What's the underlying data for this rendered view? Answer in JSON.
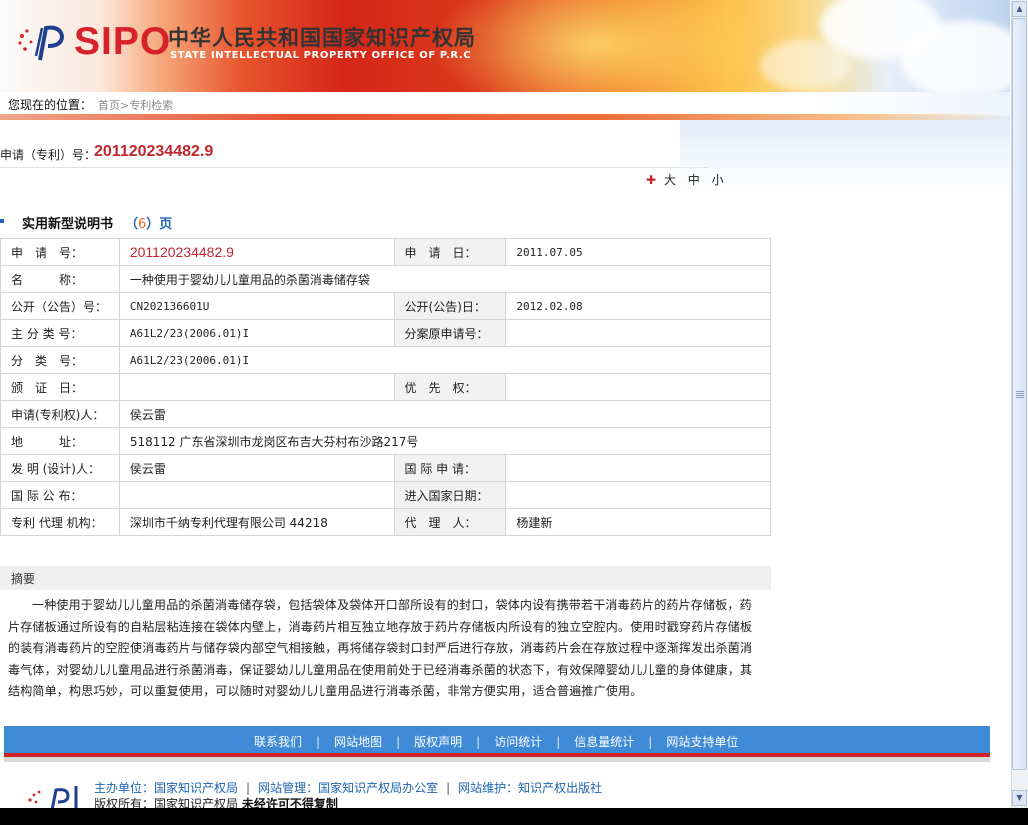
{
  "header": {
    "logo_text": "SIPO",
    "cn_title": "中华人民共和国国家知识产权局",
    "en_title": "STATE INTELLECTUAL PROPERTY OFFICE OF P.R.C"
  },
  "location": {
    "label": "您现在的位置：",
    "breadcrumb": "首页>专利检索"
  },
  "application": {
    "label": "申请（专利）号：",
    "number": "201120234482.9"
  },
  "font_size": {
    "plus": "✚",
    "large": "大",
    "medium": "中",
    "small": "小"
  },
  "section": {
    "title": "实用新型说明书",
    "pages_open": "（",
    "pages_num": "6",
    "pages_close": "）页"
  },
  "table": {
    "r1": {
      "l1": "申　请　号：",
      "v1": "201120234482.9",
      "l2": "申　请　日：",
      "v2": "2011.07.05"
    },
    "r2": {
      "l1": "名　　　称：",
      "v1": "一种使用于婴幼儿儿童用品的杀菌消毒储存袋"
    },
    "r3": {
      "l1": "公开（公告）号：",
      "v1": "CN202136601U",
      "l2": "公开(公告)日：",
      "v2": "2012.02.08"
    },
    "r4": {
      "l1": "主 分 类 号：",
      "v1": "A61L2/23(2006.01)I",
      "l2": "分案原申请号：",
      "v2": ""
    },
    "r5": {
      "l1": "分　类　号：",
      "v1": "A61L2/23(2006.01)I"
    },
    "r6": {
      "l1": "颁　证　日：",
      "v1": "",
      "l2": "优　先　权：",
      "v2": ""
    },
    "r7": {
      "l1": "申请(专利权)人：",
      "v1": "侯云雷"
    },
    "r8": {
      "l1": "地　　　址：",
      "v1": "518112 广东省深圳市龙岗区布吉大芬村布沙路217号"
    },
    "r9": {
      "l1": "发 明 (设计)人：",
      "v1": "侯云雷",
      "l2": "国 际 申 请：",
      "v2": ""
    },
    "r10": {
      "l1": "国 际 公 布：",
      "v1": "",
      "l2": "进入国家日期：",
      "v2": ""
    },
    "r11": {
      "l1": "专利 代理 机构：",
      "v1": "深圳市千纳专利代理有限公司 44218",
      "l2": "代　理　人：",
      "v2": "杨建新"
    }
  },
  "abstract": {
    "heading": "摘要",
    "text": "一种使用于婴幼儿儿童用品的杀菌消毒储存袋，包括袋体及袋体开口部所设有的封口，袋体内设有携带若干消毒药片的药片存储板，药片存储板通过所设有的自粘层粘连接在袋体内壁上，消毒药片相互独立地存放于药片存储板内所设有的独立空腔内。使用时戳穿药片存储板的装有消毒药片的空腔使消毒药片与储存袋内部空气相接触，再将储存袋封口封严后进行存放，消毒药片会在存放过程中逐渐挥发出杀菌消毒气体，对婴幼儿儿童用品进行杀菌消毒，保证婴幼儿儿童用品在使用前处于已经消毒杀菌的状态下，有效保障婴幼儿儿童的身体健康，其结构简单，构思巧妙，可以重复使用，可以随时对婴幼儿儿童用品进行消毒杀菌，非常方便实用，适合普遍推广使用。"
  },
  "footer": {
    "links": [
      "联系我们",
      "网站地图",
      "版权声明",
      "访问统计",
      "信息量统计",
      "网站支持单位"
    ],
    "separator": "|",
    "org": {
      "host": "主办单位：国家知识产权局",
      "manage": "网站管理：国家知识产权局办公室",
      "maintain": "网站维护：知识产权出版社"
    },
    "copyright_prefix": "版权所有：国家知识产权局",
    "copyright_bold": "未经许可不得复制"
  },
  "colors": {
    "accent_red": "#c0262f",
    "link_blue": "#1d63b0",
    "footer_blue": "#3f8ad7"
  }
}
